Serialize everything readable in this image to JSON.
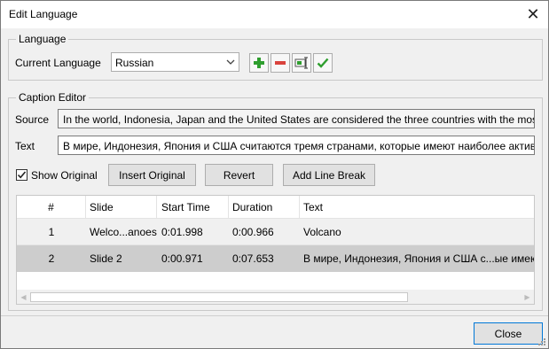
{
  "window": {
    "title": "Edit Language"
  },
  "language_group": {
    "legend": "Language",
    "current_label": "Current Language",
    "selected": "Russian"
  },
  "caption_group": {
    "legend": "Caption Editor",
    "source_label": "Source",
    "source_value": "In the world, Indonesia, Japan and the United States are considered the three countries with the most",
    "text_label": "Text",
    "text_value": "В мире, Индонезия, Япония и США считаются тремя странами, которые имеют наиболее активн",
    "show_original_label": "Show Original",
    "show_original_checked": true,
    "buttons": {
      "insert": "Insert Original",
      "revert": "Revert",
      "line_break": "Add Line Break"
    }
  },
  "table": {
    "headers": [
      "#",
      "Slide",
      "Start Time",
      "Duration",
      "Text"
    ],
    "rows": [
      [
        "1",
        "Welco...anoes",
        "0:01.998",
        "0:00.966",
        "Volcano"
      ],
      [
        "2",
        "Slide 2",
        "0:00.971",
        "0:07.653",
        "В мире, Индонезия, Япония и США с...ые имеют"
      ]
    ]
  },
  "footer": {
    "close": "Close"
  },
  "colors": {
    "add": "#2e9e2e",
    "remove": "#d9433d",
    "confirm": "#2e9e2e",
    "selected_row": "#cdcdcd"
  }
}
